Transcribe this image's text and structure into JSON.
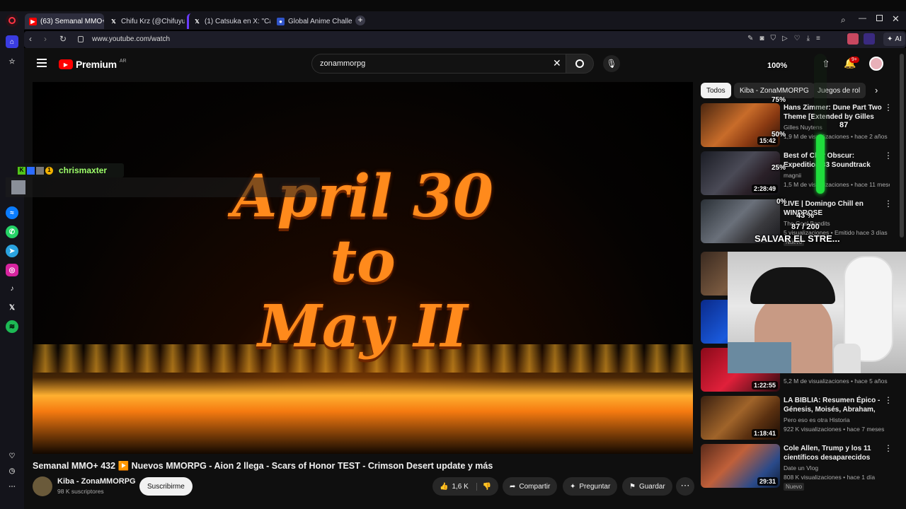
{
  "browser": {
    "tabs": [
      {
        "title": "(63) Semanal MMO+ 432",
        "icon": "youtube-icon"
      },
      {
        "title": "Chifu Krz (@ChifuyuMats…",
        "icon": "x-icon"
      },
      {
        "title": "(1) Catsuka en X: \"Can't w…",
        "icon": "x-icon"
      },
      {
        "title": "Global Anime Challenge: C…",
        "icon": "globe-icon"
      }
    ],
    "new_tab": "+",
    "url": "www.youtube.com/watch",
    "ai_label": "AI"
  },
  "youtube": {
    "logo": "Premium",
    "region": "AR",
    "search_value": "zonammorpg",
    "notif_count": "9+",
    "chips": [
      "Todos",
      "Kiba - ZonaMMORPG",
      "Juegos de rol"
    ]
  },
  "video": {
    "line1": "April 30",
    "line2": "to",
    "line3": "May II",
    "title": "Semanal MMO+ 432 ▶️ Nuevos MMORPG - Aion 2 llega - Scars of Honor TEST - Crimson Desert update y más",
    "channel": "Kiba - ZonaMMORPG",
    "subs": "98 K suscriptores",
    "subscribe": "Suscribirme",
    "likes": "1,6 K",
    "share": "Compartir",
    "ask": "Preguntar",
    "save": "Guardar"
  },
  "related": [
    {
      "title": "Hans Zimmer: Dune Part Two Theme [Extended by Gilles …",
      "channel": "Gilles Nuytens",
      "meta": "1,9 M de visualizaciones • hace 2 años",
      "duration": "15:42"
    },
    {
      "title": "Best of Clair Obscur: Expedition 33 Soundtrack",
      "channel": "magnii",
      "meta": "1,5 M de visualizaciones • hace 11 meses",
      "duration": "2:28:49"
    },
    {
      "title": "LIVE | Domingo Chill en WINDROSE",
      "channel": "The Goal Bandits",
      "meta": "5 visualizaciones • Emitido hace 3 días",
      "badge": "Nuevo"
    },
    {
      "title": "",
      "channel": "",
      "meta": "5,2 M de visualizaciones • hace 5 años",
      "duration": "1:22:55"
    },
    {
      "title": "LA BIBLIA: Resumen Épico - Génesis, Moisés, Abraham, …",
      "channel": "Pero eso es otra Historia",
      "meta": "922 K visualizaciones • hace 7 meses",
      "duration": "1:18:41"
    },
    {
      "title": "Cole Allen, Trump y los 11 científicos desaparecidos",
      "channel": "Date un Vlog",
      "meta": "808 K visualizaciones • hace 1 día",
      "duration": "29:31",
      "badge": "Nuevo"
    }
  ],
  "overlay": {
    "chat_user": "chrismaxter",
    "meter_top": "100%",
    "meter_75": "75%",
    "meter_50": "50%",
    "meter_25": "25%",
    "meter_0": "0%",
    "meter_value": "87",
    "meter_pct": "43 %",
    "goal": "87 / 200",
    "goal_label": "SALVAR EL STRE...",
    "meter_level": 0.435
  },
  "colors": {
    "yt_red": "#ff0000",
    "bg": "#0f0f0f",
    "meter_green": "#1fdc3c"
  }
}
